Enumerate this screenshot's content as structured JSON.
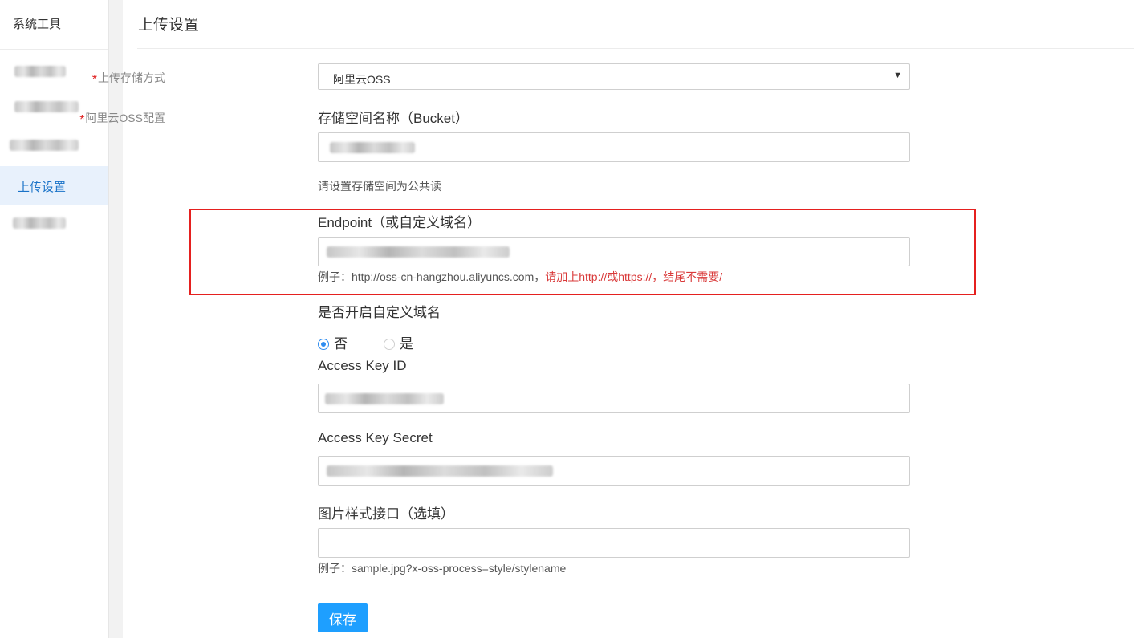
{
  "sidebar": {
    "title": "系统工具",
    "active_item": "上传设置"
  },
  "page": {
    "title": "上传设置"
  },
  "form": {
    "storage_method": {
      "required_mark": "*",
      "label": "上传存储方式",
      "selected": "阿里云OSS",
      "caret": "▼"
    },
    "oss_config": {
      "required_mark": "*",
      "label": "阿里云OSS配置"
    },
    "bucket": {
      "label": "存储空间名称（Bucket）",
      "hint": "请设置存储空间为公共读"
    },
    "endpoint": {
      "label": "Endpoint（或自定义域名）",
      "hint_example": "例子：http://oss-cn-hangzhou.aliyuncs.com，",
      "hint_warning": "请加上http://或https://，结尾不需要/"
    },
    "custom_domain": {
      "label": "是否开启自定义域名",
      "options": [
        "否",
        "是"
      ],
      "selected": "否"
    },
    "access_key_id": {
      "label": "Access Key ID"
    },
    "access_key_secret": {
      "label": "Access Key Secret"
    },
    "image_style": {
      "label": "图片样式接口（选填）",
      "value": "",
      "hint": "例子：sample.jpg?x-oss-process=style/stylename"
    },
    "save_label": "保存"
  },
  "colors": {
    "primary": "#1e9fff",
    "radio_accent": "#2d8cf0",
    "required": "#e02020",
    "warning_text": "#d93a3a",
    "highlight_border": "#e5201f",
    "active_bg": "#e8f1fc"
  }
}
